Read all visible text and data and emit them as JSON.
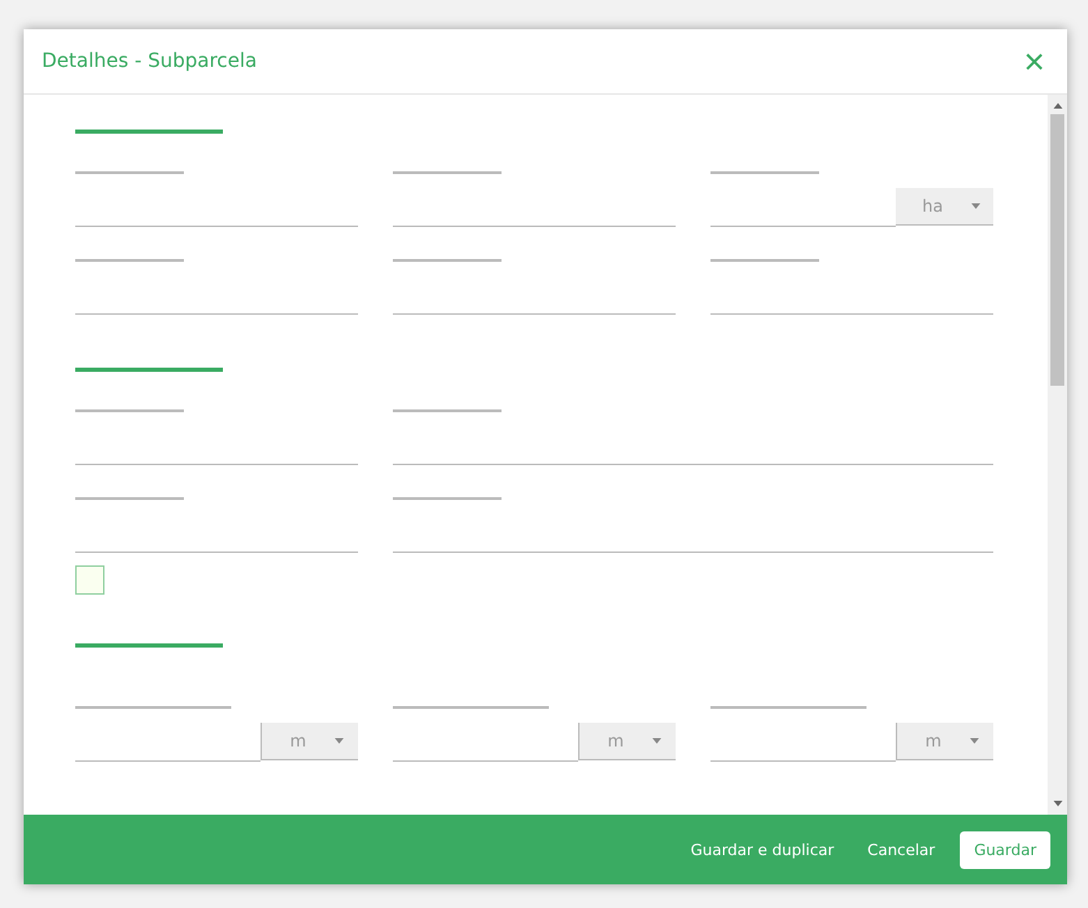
{
  "dialog": {
    "title": "Detalhes - Subparcela",
    "close": "×"
  },
  "sections": [
    {
      "rows": [
        {
          "fields": [
            {
              "kind": "text"
            },
            {
              "kind": "text"
            },
            {
              "kind": "unit",
              "unit": "ha"
            }
          ]
        },
        {
          "fields": [
            {
              "kind": "text"
            },
            {
              "kind": "text"
            },
            {
              "kind": "text"
            }
          ]
        }
      ]
    },
    {
      "rows": [
        {
          "fields": [
            {
              "kind": "text"
            },
            {
              "kind": "wide"
            }
          ]
        },
        {
          "fields": [
            {
              "kind": "text"
            },
            {
              "kind": "wide"
            }
          ]
        }
      ]
    },
    {
      "checkbox": {
        "checked": false
      }
    },
    {
      "rows": [
        {
          "fields": [
            {
              "kind": "unit",
              "unit": "m"
            },
            {
              "kind": "unit",
              "unit": "m"
            },
            {
              "kind": "unit",
              "unit": "m"
            }
          ]
        }
      ]
    }
  ],
  "footer": {
    "buttons": [
      {
        "label": "Guardar e duplicar",
        "kind": "link"
      },
      {
        "label": "Cancelar",
        "kind": "link"
      },
      {
        "label": "Guardar",
        "kind": "primary"
      }
    ]
  }
}
